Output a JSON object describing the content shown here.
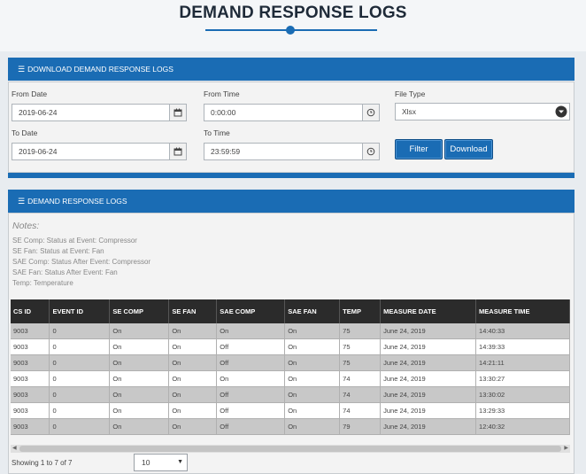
{
  "page_title": "DEMAND RESPONSE LOGS",
  "download_panel": {
    "heading": "DOWNLOAD DEMAND RESPONSE LOGS",
    "from_date_label": "From Date",
    "from_date_value": "2019-06-24",
    "to_date_label": "To Date",
    "to_date_value": "2019-06-24",
    "from_time_label": "From Time",
    "from_time_value": "0:00:00",
    "to_time_label": "To Time",
    "to_time_value": "23:59:59",
    "file_type_label": "File Type",
    "file_type_value": "Xlsx",
    "filter_button": "Filter",
    "download_button": "Download"
  },
  "logs_panel": {
    "heading": "DEMAND RESPONSE LOGS",
    "notes_title": "Notes:",
    "notes": [
      "SE Comp: Status at Event: Compressor",
      "SE Fan: Status at Event: Fan",
      "SAE Comp: Status After Event: Compressor",
      "SAE Fan: Status After Event: Fan",
      "Temp: Temperature"
    ]
  },
  "table": {
    "columns": [
      "CS ID",
      "EVENT ID",
      "SE COMP",
      "SE FAN",
      "SAE COMP",
      "SAE FAN",
      "TEMP",
      "MEASURE DATE",
      "MEASURE TIME"
    ],
    "rows": [
      [
        "9003",
        "0",
        "On",
        "On",
        "On",
        "On",
        "75",
        "June 24, 2019",
        "14:40:33"
      ],
      [
        "9003",
        "0",
        "On",
        "On",
        "Off",
        "On",
        "75",
        "June 24, 2019",
        "14:39:33"
      ],
      [
        "9003",
        "0",
        "On",
        "On",
        "Off",
        "On",
        "75",
        "June 24, 2019",
        "14:21:11"
      ],
      [
        "9003",
        "0",
        "On",
        "On",
        "On",
        "On",
        "74",
        "June 24, 2019",
        "13:30:27"
      ],
      [
        "9003",
        "0",
        "On",
        "On",
        "Off",
        "On",
        "74",
        "June 24, 2019",
        "13:30:02"
      ],
      [
        "9003",
        "0",
        "On",
        "On",
        "Off",
        "On",
        "74",
        "June 24, 2019",
        "13:29:33"
      ],
      [
        "9003",
        "0",
        "On",
        "On",
        "Off",
        "On",
        "79",
        "June 24, 2019",
        "12:40:32"
      ]
    ]
  },
  "footer": {
    "showing_text": "Showing 1 to 7 of 7",
    "page_size": "10"
  },
  "icons": {
    "list": "list-icon",
    "calendar": "calendar-icon",
    "clock": "clock-icon",
    "dropdown": "chevron-down-circle-icon"
  },
  "colors": {
    "accent": "#1a6cb4",
    "table_header": "#2b2b2b",
    "row_shaded": "#c8c8c8"
  }
}
